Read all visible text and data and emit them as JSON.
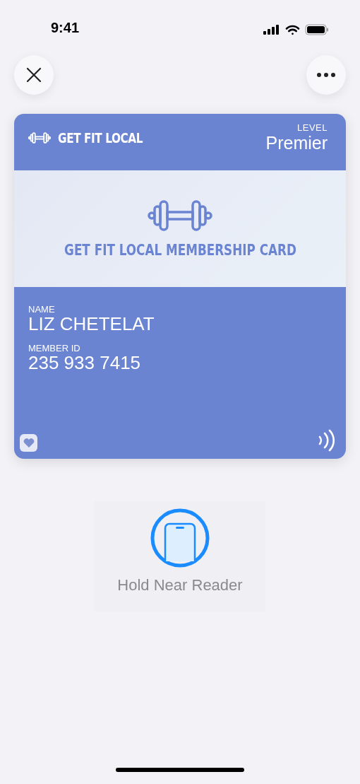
{
  "status_bar": {
    "time": "9:41"
  },
  "card": {
    "brand": "GET FIT LOCAL",
    "level_label": "LEVEL",
    "level_value": "Premier",
    "title": "GET FIT LOCAL MEMBERSHIP CARD",
    "fields": [
      {
        "label": "NAME",
        "value": "LIZ CHETELAT"
      },
      {
        "label": "MEMBER ID",
        "value": "235 933 7415"
      }
    ]
  },
  "reader": {
    "prompt": "Hold Near Reader"
  }
}
